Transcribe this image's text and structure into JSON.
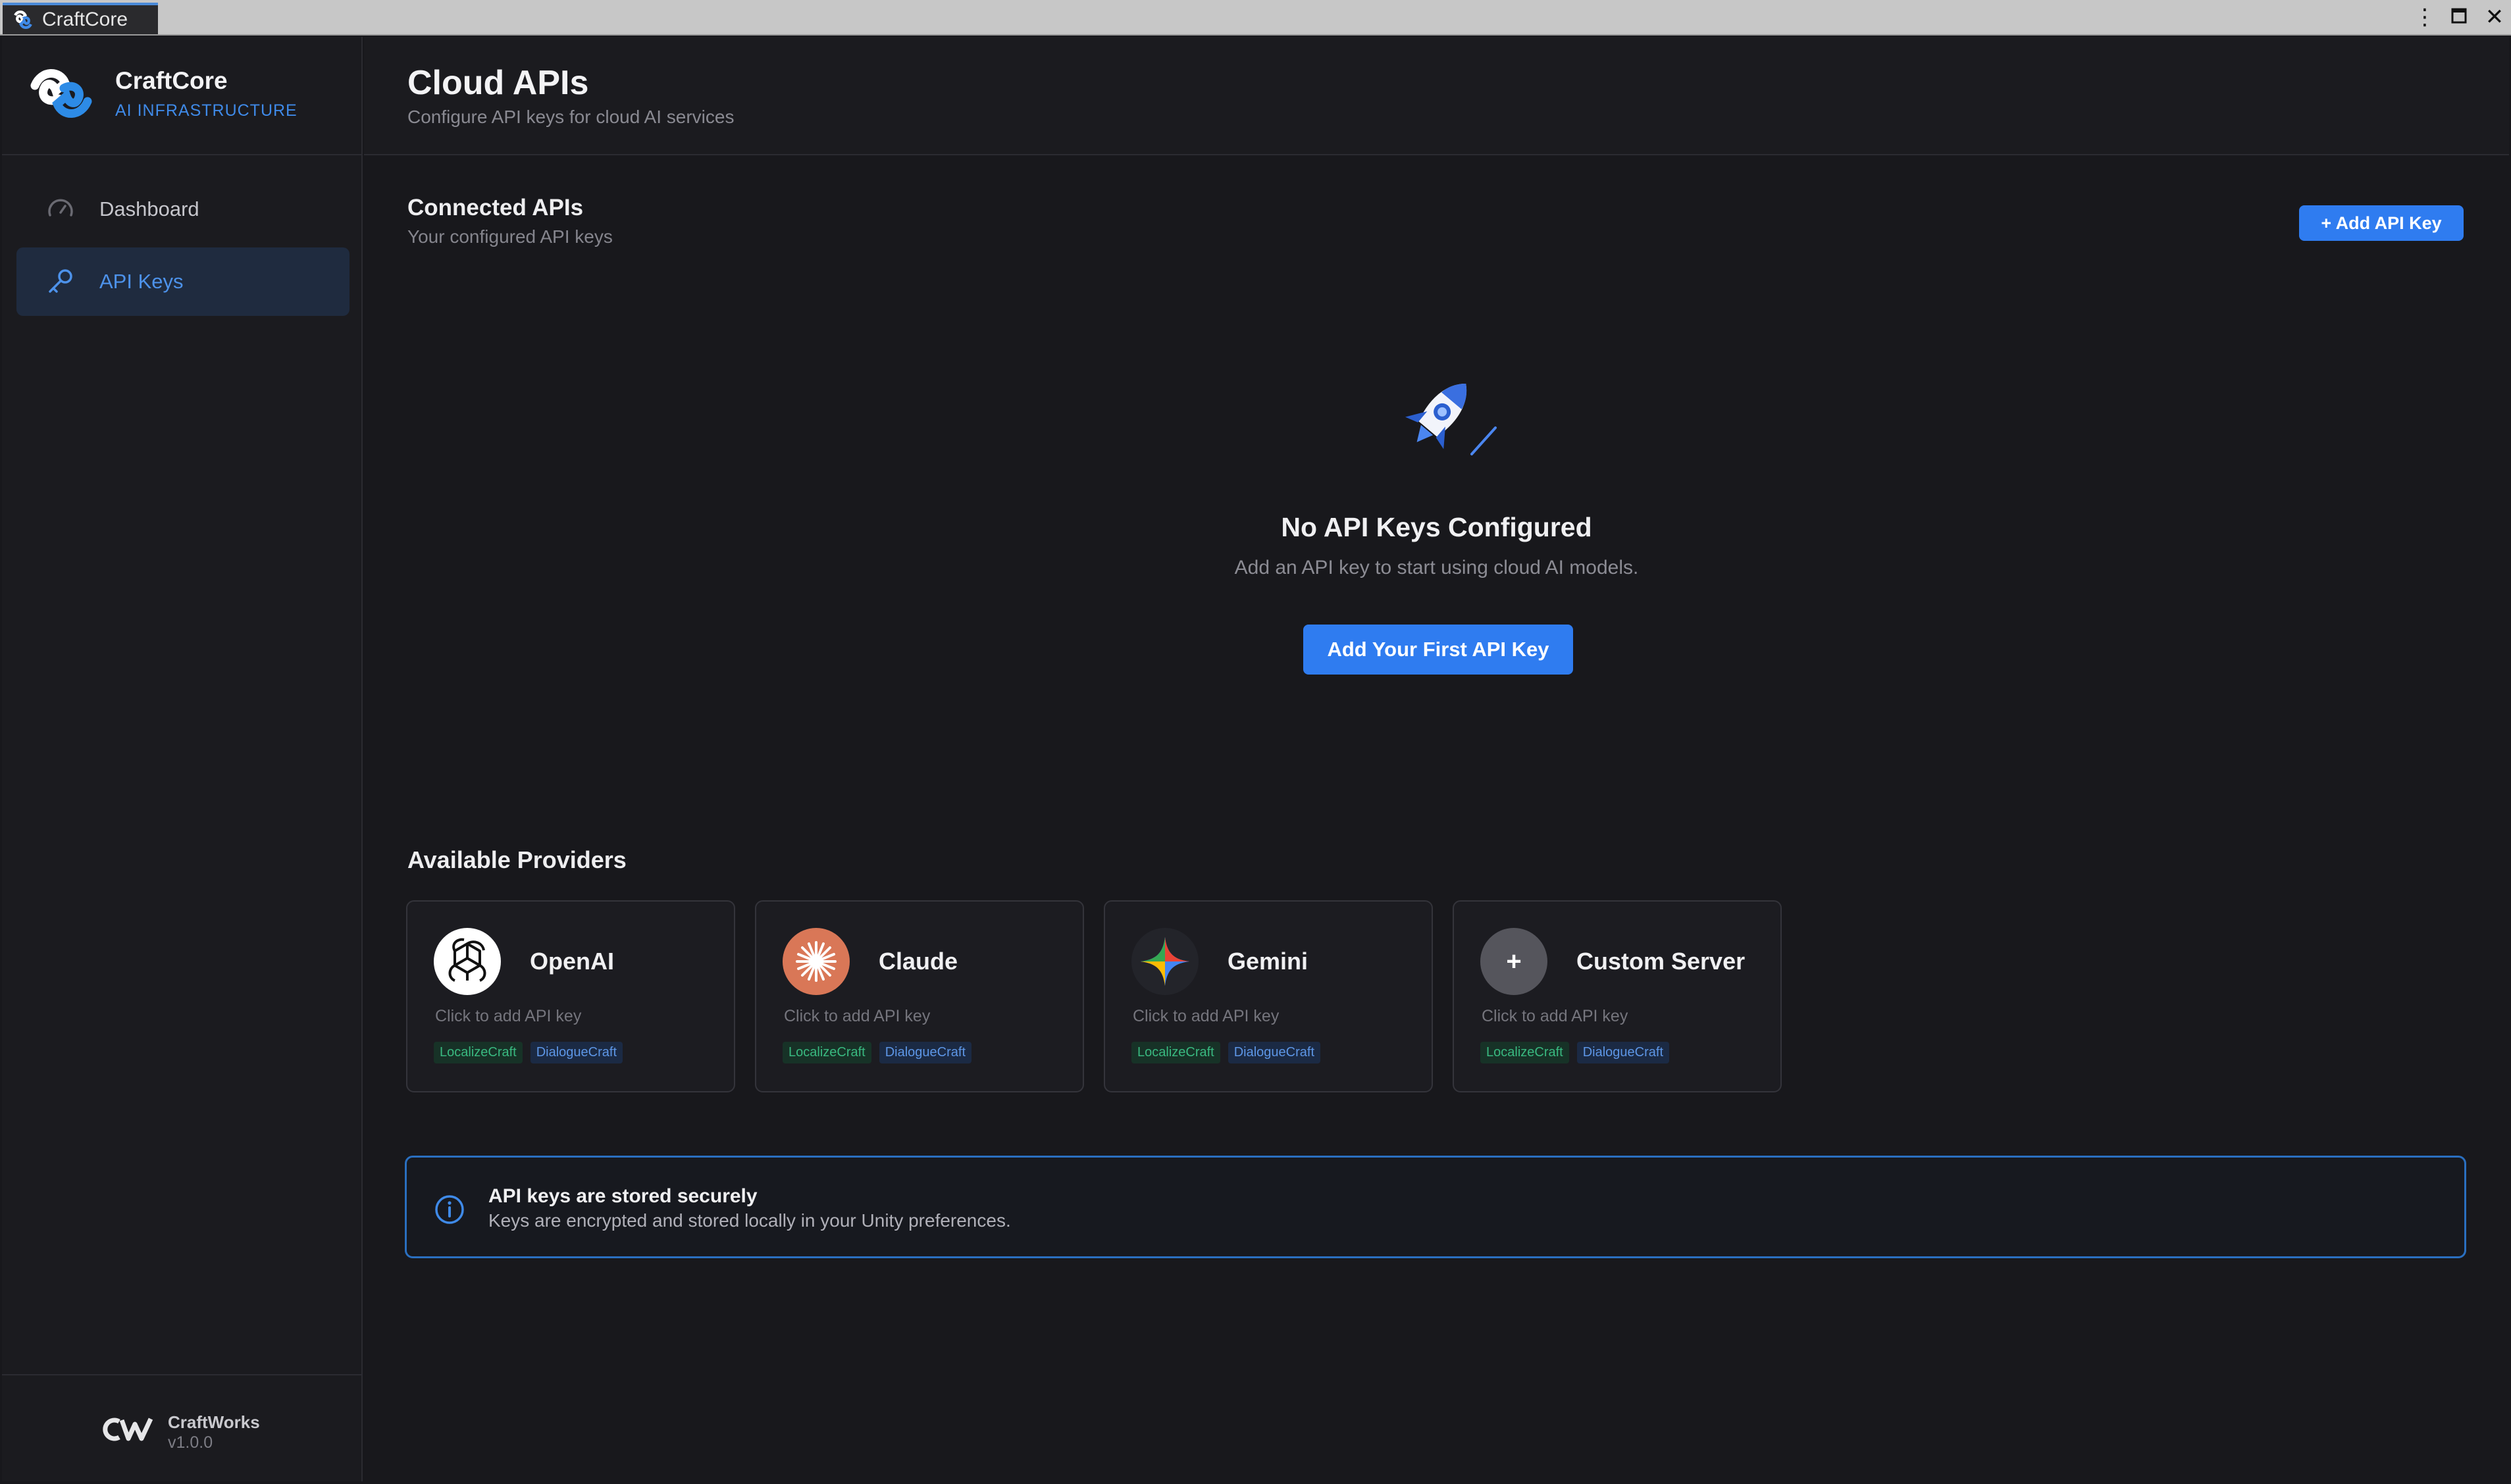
{
  "window": {
    "tab_title": "CraftCore",
    "controls": {
      "menu": "⋮",
      "maximize": "🗖",
      "close": "✕"
    }
  },
  "sidebar": {
    "brand": {
      "name": "CraftCore",
      "subtitle": "AI INFRASTRUCTURE"
    },
    "items": [
      {
        "label": "Dashboard",
        "icon": "gauge-icon",
        "active": false
      },
      {
        "label": "API Keys",
        "icon": "key-icon",
        "active": true
      }
    ],
    "footer": {
      "name": "CraftWorks",
      "version": "v1.0.0"
    }
  },
  "header": {
    "title": "Cloud APIs",
    "subtitle": "Configure API keys for cloud AI services"
  },
  "connected": {
    "title": "Connected APIs",
    "subtitle": "Your configured API keys",
    "add_button": "+ Add API Key",
    "empty": {
      "icon": "rocket-icon",
      "title": "No API Keys Configured",
      "description": "Add an API key to start using cloud AI models.",
      "button": "Add Your First API Key"
    }
  },
  "providers": {
    "title": "Available Providers",
    "items": [
      {
        "name": "OpenAI",
        "hint": "Click to add API key",
        "icon": "openai-icon",
        "tags": [
          "LocalizeCraft",
          "DialogueCraft"
        ]
      },
      {
        "name": "Claude",
        "hint": "Click to add API key",
        "icon": "claude-icon",
        "tags": [
          "LocalizeCraft",
          "DialogueCraft"
        ]
      },
      {
        "name": "Gemini",
        "hint": "Click to add API key",
        "icon": "gemini-icon",
        "tags": [
          "LocalizeCraft",
          "DialogueCraft"
        ]
      },
      {
        "name": "Custom Server",
        "hint": "Click to add API key",
        "icon": "plus-icon",
        "plus_glyph": "+",
        "tags": [
          "LocalizeCraft",
          "DialogueCraft"
        ]
      }
    ]
  },
  "info": {
    "title": "API keys are stored securely",
    "description": "Keys are encrypted and stored locally in your Unity preferences."
  },
  "colors": {
    "accent": "#2f7cf0",
    "sidebar_active_bg": "#1f2b3f",
    "background": "#18181c",
    "tag_green": "#39b980",
    "tag_blue": "#5d96e6",
    "claude_orange": "#d97757"
  }
}
